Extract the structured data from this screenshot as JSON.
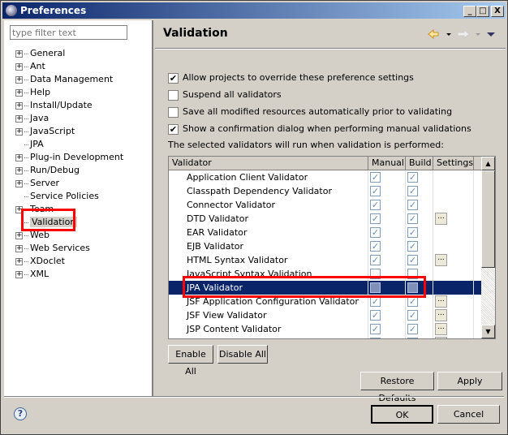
{
  "window": {
    "title": "Preferences",
    "minimize": "_",
    "maximize": "□",
    "close": "X"
  },
  "sidebar": {
    "filter_placeholder": "type filter text",
    "items": [
      {
        "label": "General",
        "expandable": true
      },
      {
        "label": "Ant",
        "expandable": true
      },
      {
        "label": "Data Management",
        "expandable": true
      },
      {
        "label": "Help",
        "expandable": true
      },
      {
        "label": "Install/Update",
        "expandable": true
      },
      {
        "label": "Java",
        "expandable": true
      },
      {
        "label": "JavaScript",
        "expandable": true
      },
      {
        "label": "JPA",
        "expandable": false
      },
      {
        "label": "Plug-in Development",
        "expandable": true
      },
      {
        "label": "Run/Debug",
        "expandable": true
      },
      {
        "label": "Server",
        "expandable": true
      },
      {
        "label": "Service Policies",
        "expandable": false
      },
      {
        "label": "Team",
        "expandable": true
      },
      {
        "label": "Validation",
        "expandable": false,
        "selected": true
      },
      {
        "label": "Web",
        "expandable": true
      },
      {
        "label": "Web Services",
        "expandable": true
      },
      {
        "label": "XDoclet",
        "expandable": true
      },
      {
        "label": "XML",
        "expandable": true
      }
    ]
  },
  "main": {
    "title": "Validation",
    "nav_icons": [
      "back-arrow-icon",
      "forward-arrow-icon",
      "view-menu-icon"
    ],
    "options": [
      {
        "label": "Allow projects to override these preference settings",
        "checked": true
      },
      {
        "label": "Suspend all validators",
        "checked": false
      },
      {
        "label": "Save all modified resources automatically prior to validating",
        "checked": false
      },
      {
        "label": "Show a confirmation dialog when performing manual validations",
        "checked": true
      }
    ],
    "table_caption": "The selected validators will run when validation is performed:",
    "columns": [
      "Validator",
      "Manual",
      "Build",
      "Settings"
    ],
    "rows": [
      {
        "name": "Application Client Validator",
        "manual": true,
        "build": true,
        "settings": false
      },
      {
        "name": "Classpath Dependency Validator",
        "manual": true,
        "build": true,
        "settings": false
      },
      {
        "name": "Connector Validator",
        "manual": true,
        "build": true,
        "settings": false
      },
      {
        "name": "DTD Validator",
        "manual": true,
        "build": true,
        "settings": true
      },
      {
        "name": "EAR Validator",
        "manual": true,
        "build": true,
        "settings": false
      },
      {
        "name": "EJB Validator",
        "manual": true,
        "build": true,
        "settings": false
      },
      {
        "name": "HTML Syntax Validator",
        "manual": true,
        "build": true,
        "settings": true
      },
      {
        "name": "JavaScript Syntax Validation",
        "manual": false,
        "build": false,
        "settings": false
      },
      {
        "name": "JPA Validator",
        "manual": false,
        "build": false,
        "settings": false,
        "selected": true
      },
      {
        "name": "JSF Application Configuration Validator",
        "manual": true,
        "build": true,
        "settings": true
      },
      {
        "name": "JSF View Validator",
        "manual": true,
        "build": true,
        "settings": true
      },
      {
        "name": "JSP Content Validator",
        "manual": true,
        "build": true,
        "settings": true
      }
    ],
    "settings_button": "...",
    "enable_all": "Enable All",
    "disable_all": "Disable All",
    "restore_defaults": "Restore Defaults",
    "apply": "Apply"
  },
  "footer": {
    "ok": "OK",
    "cancel": "Cancel",
    "help_icon": "?"
  },
  "colors": {
    "selection": "#0a246a",
    "highlight": "#ff0000",
    "titlebar": "#0a246a"
  }
}
